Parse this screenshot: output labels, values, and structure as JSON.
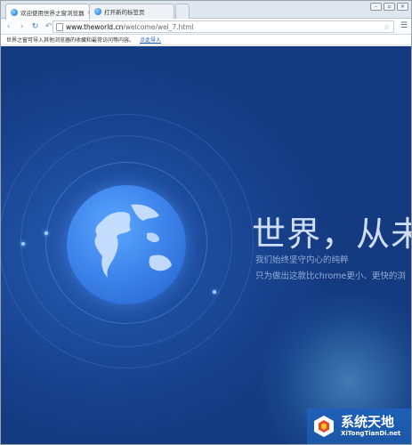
{
  "tabs": [
    {
      "label": "欢迎使用世界之窗浏览器",
      "close": "×",
      "active": true
    },
    {
      "label": "打开新的标签页",
      "close": "",
      "active": false
    }
  ],
  "toolbar": {
    "back_icon": "‹",
    "forward_icon": "›",
    "refresh_icon": "↻",
    "undo_icon": "↶",
    "url_host": "www.theworld.cn",
    "url_path": "/welcome/wel_7.html",
    "star_icon": "☆",
    "menu_icon": "☰"
  },
  "notice": {
    "text": "世界之窗可导入其他浏览器的收藏和最常访问等内容。",
    "link": "点此导入"
  },
  "hero": {
    "headline": "世界，从未这",
    "line1": "我们始终坚守内心的纯粹",
    "line2": "只为做出这款比chrome更小、更快的浏"
  },
  "watermark": {
    "cn": "系统天地",
    "en": "XiTongTianDi.net"
  },
  "colors": {
    "background": "#17408a",
    "globe": "#3f86ec",
    "accent": "#8fd4ff"
  }
}
